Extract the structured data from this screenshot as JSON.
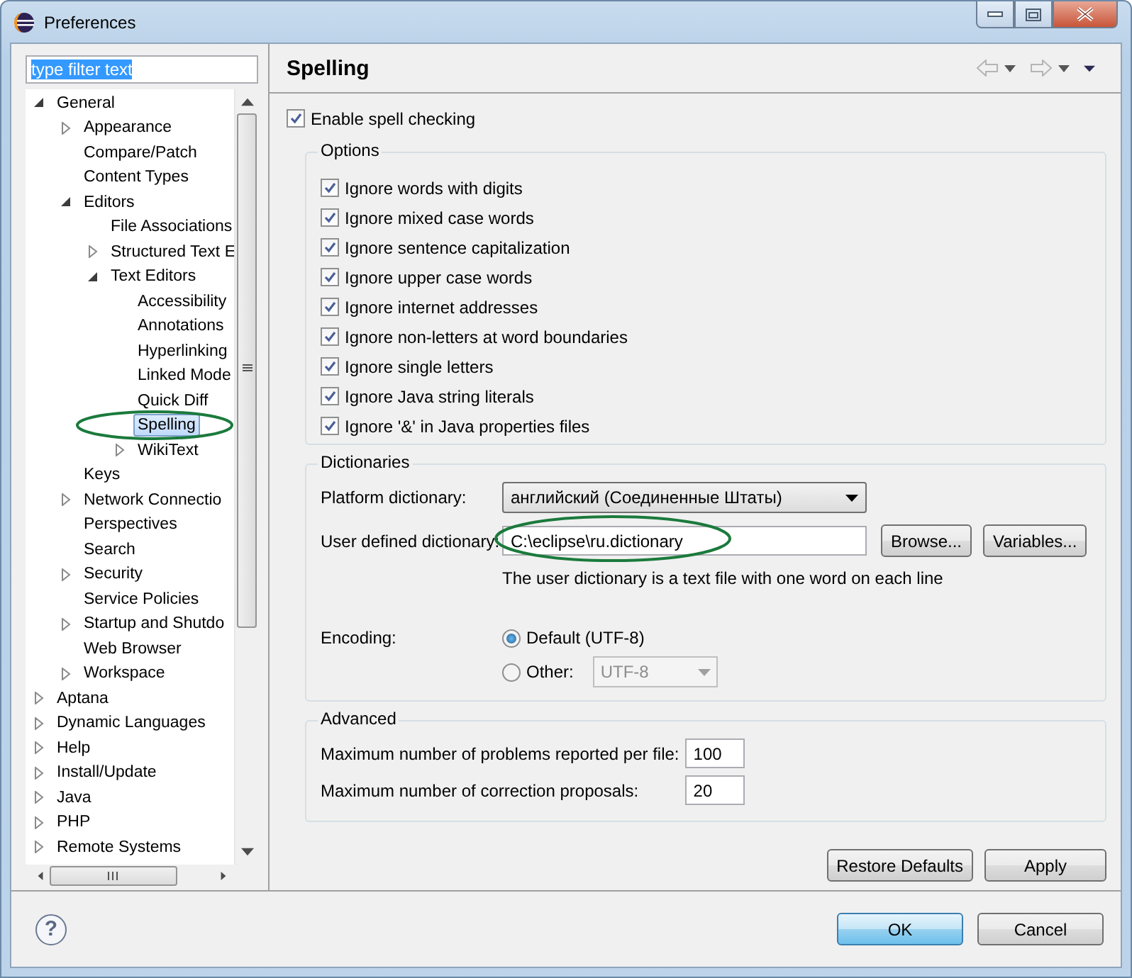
{
  "window": {
    "title": "Preferences"
  },
  "filter": {
    "value": "type filter text",
    "selected": true
  },
  "tree": {
    "items": [
      {
        "label": "General",
        "expanded": true,
        "selected": false,
        "children": [
          {
            "label": "Appearance",
            "expanded": false,
            "selected": false
          },
          {
            "label": "Compare/Patch",
            "selected": false
          },
          {
            "label": "Content Types",
            "selected": false
          },
          {
            "label": "Editors",
            "expanded": true,
            "selected": false,
            "children": [
              {
                "label": "File Associations",
                "selected": false
              },
              {
                "label": "Structured Text E",
                "expanded": false,
                "selected": false
              },
              {
                "label": "Text Editors",
                "expanded": true,
                "selected": false,
                "children": [
                  {
                    "label": "Accessibility",
                    "selected": false
                  },
                  {
                    "label": "Annotations",
                    "selected": false
                  },
                  {
                    "label": "Hyperlinking",
                    "selected": false
                  },
                  {
                    "label": "Linked Mode",
                    "selected": false
                  },
                  {
                    "label": "Quick Diff",
                    "selected": false
                  },
                  {
                    "label": "Spelling",
                    "selected": true,
                    "circled": true
                  },
                  {
                    "label": "WikiText",
                    "expanded": false,
                    "selected": false
                  }
                ]
              }
            ]
          },
          {
            "label": "Keys",
            "selected": false
          },
          {
            "label": "Network Connectio",
            "expanded": false,
            "selected": false
          },
          {
            "label": "Perspectives",
            "selected": false
          },
          {
            "label": "Search",
            "selected": false
          },
          {
            "label": "Security",
            "expanded": false,
            "selected": false
          },
          {
            "label": "Service Policies",
            "selected": false
          },
          {
            "label": "Startup and Shutdo",
            "expanded": false,
            "selected": false
          },
          {
            "label": "Web Browser",
            "selected": false
          },
          {
            "label": "Workspace",
            "expanded": false,
            "selected": false
          }
        ]
      },
      {
        "label": "Aptana",
        "expanded": false,
        "selected": false
      },
      {
        "label": "Dynamic Languages",
        "expanded": false,
        "selected": false
      },
      {
        "label": "Help",
        "expanded": false,
        "selected": false
      },
      {
        "label": "Install/Update",
        "expanded": false,
        "selected": false
      },
      {
        "label": "Java",
        "expanded": false,
        "selected": false
      },
      {
        "label": "PHP",
        "expanded": false,
        "selected": false
      },
      {
        "label": "Remote Systems",
        "expanded": false,
        "selected": false
      }
    ]
  },
  "page": {
    "title": "Spelling",
    "nav": [
      {
        "kind": "back",
        "disabled": true
      },
      {
        "kind": "forward",
        "disabled": true
      },
      {
        "kind": "menu",
        "disabled": false
      }
    ],
    "enable": {
      "label": "Enable spell checking",
      "checked": true
    },
    "options": {
      "title": "Options",
      "items": [
        {
          "label": "Ignore words with digits",
          "checked": true
        },
        {
          "label": "Ignore mixed case words",
          "checked": true
        },
        {
          "label": "Ignore sentence capitalization",
          "checked": true
        },
        {
          "label": "Ignore upper case words",
          "checked": true
        },
        {
          "label": "Ignore internet addresses",
          "checked": true
        },
        {
          "label": "Ignore non-letters at word boundaries",
          "checked": true
        },
        {
          "label": "Ignore single letters",
          "checked": true
        },
        {
          "label": "Ignore Java string literals",
          "checked": true
        },
        {
          "label": "Ignore '&' in Java properties files",
          "checked": true
        }
      ]
    },
    "dictionaries": {
      "title": "Dictionaries",
      "platform": {
        "label": "Platform dictionary:",
        "value": "английский (Соединенные Штаты)"
      },
      "user": {
        "label": "User defined dictionary:",
        "value": "C:\\eclipse\\ru.dictionary",
        "circled": true
      },
      "buttons": [
        "Browse...",
        "Variables..."
      ],
      "note": "The user dictionary is a text file with one word on each line",
      "encoding": {
        "label": "Encoding:",
        "choices": [
          {
            "label": "Default (UTF-8)",
            "selected": true
          },
          {
            "label": "Other:",
            "selected": false,
            "combo": {
              "value": "UTF-8",
              "disabled": true
            }
          }
        ]
      }
    },
    "advanced": {
      "title": "Advanced",
      "fields": [
        {
          "label": "Maximum number of problems reported per file:",
          "value": "100"
        },
        {
          "label": "Maximum number of correction proposals:",
          "value": "20"
        }
      ]
    },
    "buttons": [
      "Restore Defaults",
      "Apply"
    ]
  },
  "footer": {
    "help": "?",
    "buttons": [
      {
        "label": "OK",
        "default": true
      },
      {
        "label": "Cancel",
        "default": false
      }
    ]
  }
}
